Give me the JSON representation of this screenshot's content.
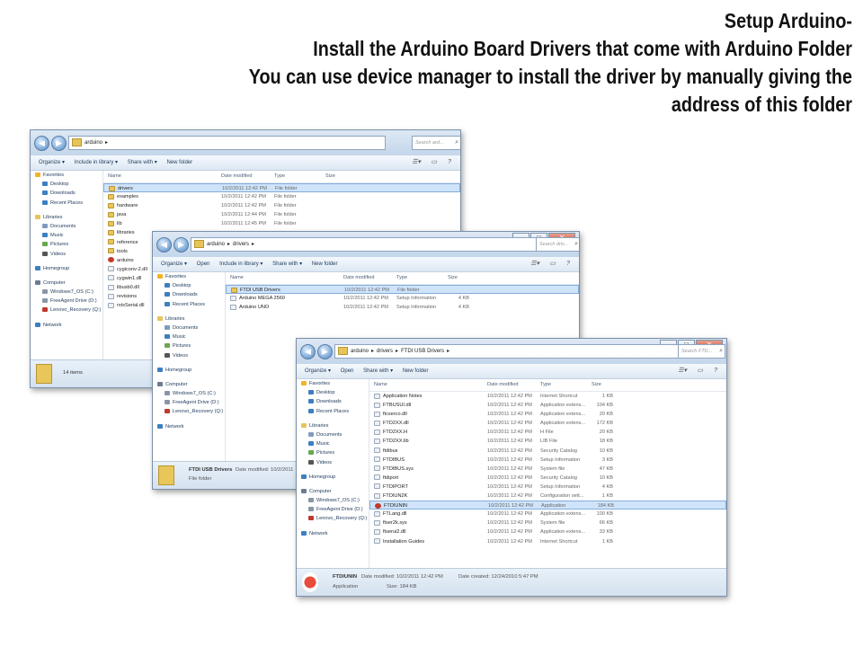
{
  "heading": {
    "line1": "Setup Arduino-",
    "line2": "Install the Arduino Board Drivers that come with Arduino Folder",
    "line3": "You can use device manager to install the driver by manually giving the",
    "line4": "address of this folder"
  },
  "columns": {
    "name": "Name",
    "date": "Date modified",
    "type": "Type",
    "size": "Size"
  },
  "nav": {
    "favorites": "Favorites",
    "desktop": "Desktop",
    "downloads": "Downloads",
    "recent": "Recent Places",
    "libraries": "Libraries",
    "documents": "Documents",
    "music": "Music",
    "pictures": "Pictures",
    "videos": "Videos",
    "homegroup": "Homegroup",
    "computer": "Computer",
    "drive_c": "Windows7_OS (C:)",
    "drive_d": "FreeAgent Drive (D:)",
    "drive_q": "Lenovo_Recovery (Q:)",
    "network": "Network"
  },
  "toolbar": {
    "organize": "Organize ▾",
    "open": "Open",
    "include": "Include in library ▾",
    "share": "Share with ▾",
    "newfolder": "New folder"
  },
  "win1": {
    "crumbs": [
      "arduino"
    ],
    "search_placeholder": "Search ard...",
    "rows": [
      {
        "name": "drivers",
        "date": "10/2/2011 12:42 PM",
        "type": "File folder",
        "kind": "folder"
      },
      {
        "name": "examples",
        "date": "10/2/2011 12:42 PM",
        "type": "File folder",
        "kind": "folder"
      },
      {
        "name": "hardware",
        "date": "10/2/2011 12:42 PM",
        "type": "File folder",
        "kind": "folder"
      },
      {
        "name": "java",
        "date": "10/2/2011 12:44 PM",
        "type": "File folder",
        "kind": "folder"
      },
      {
        "name": "lib",
        "date": "10/2/2011 12:45 PM",
        "type": "File folder",
        "kind": "folder"
      },
      {
        "name": "libraries",
        "date": "",
        "type": "",
        "kind": "folder"
      },
      {
        "name": "reference",
        "date": "",
        "type": "",
        "kind": "folder"
      },
      {
        "name": "tools",
        "date": "",
        "type": "",
        "kind": "folder"
      },
      {
        "name": "arduino",
        "date": "",
        "type": "",
        "kind": "app"
      },
      {
        "name": "cygiconv-2.dll",
        "date": "",
        "type": "",
        "kind": "file"
      },
      {
        "name": "cygwin1.dll",
        "date": "",
        "type": "",
        "kind": "file"
      },
      {
        "name": "libusb0.dll",
        "date": "",
        "type": "",
        "kind": "file"
      },
      {
        "name": "revisions",
        "date": "",
        "type": "",
        "kind": "file"
      },
      {
        "name": "rxtxSerial.dll",
        "date": "",
        "type": "",
        "kind": "file"
      }
    ],
    "status": "14 items"
  },
  "win2": {
    "crumbs": [
      "arduino",
      "drivers"
    ],
    "search_placeholder": "Search driv...",
    "rows": [
      {
        "name": "FTDI USB Drivers",
        "date": "10/2/2011 12:42 PM",
        "type": "File folder",
        "size": "",
        "kind": "folder"
      },
      {
        "name": "Arduino MEGA 2560",
        "date": "10/2/2011 12:42 PM",
        "type": "Setup Information",
        "size": "4 KB",
        "kind": "file"
      },
      {
        "name": "Arduino UNO",
        "date": "10/2/2011 12:42 PM",
        "type": "Setup Information",
        "size": "4 KB",
        "kind": "file"
      }
    ],
    "status_name": "FTDI USB Drivers",
    "status_date": "Date modified: 10/2/2011",
    "status_type": "File folder"
  },
  "win3": {
    "crumbs": [
      "arduino",
      "drivers",
      "FTDI USB Drivers"
    ],
    "search_placeholder": "Search FTD...",
    "rows": [
      {
        "name": "Application Notes",
        "date": "10/2/2011 12:42 PM",
        "type": "Internet Shortcut",
        "size": "1 KB",
        "kind": "file"
      },
      {
        "name": "FTBUSUI.dll",
        "date": "10/2/2011 12:42 PM",
        "type": "Application extens...",
        "size": "104 KB",
        "kind": "file"
      },
      {
        "name": "ftcserco.dll",
        "date": "10/2/2011 12:42 PM",
        "type": "Application extens...",
        "size": "20 KB",
        "kind": "file"
      },
      {
        "name": "FTD2XX.dll",
        "date": "10/2/2011 12:42 PM",
        "type": "Application extens...",
        "size": "172 KB",
        "kind": "file"
      },
      {
        "name": "FTD2XX.H",
        "date": "10/2/2011 12:42 PM",
        "type": "H File",
        "size": "20 KB",
        "kind": "file"
      },
      {
        "name": "FTD2XX.lib",
        "date": "10/2/2011 12:42 PM",
        "type": "LIB File",
        "size": "18 KB",
        "kind": "file"
      },
      {
        "name": "ftdibus",
        "date": "10/2/2011 12:42 PM",
        "type": "Security Catalog",
        "size": "10 KB",
        "kind": "file"
      },
      {
        "name": "FTDIBUS",
        "date": "10/2/2011 12:42 PM",
        "type": "Setup Information",
        "size": "3 KB",
        "kind": "file"
      },
      {
        "name": "FTDIBUS.sys",
        "date": "10/2/2011 12:42 PM",
        "type": "System file",
        "size": "47 KB",
        "kind": "file"
      },
      {
        "name": "ftdiport",
        "date": "10/2/2011 12:42 PM",
        "type": "Security Catalog",
        "size": "10 KB",
        "kind": "file"
      },
      {
        "name": "FTDIPORT",
        "date": "10/2/2011 12:42 PM",
        "type": "Setup Information",
        "size": "4 KB",
        "kind": "file"
      },
      {
        "name": "FTDIUN2K",
        "date": "10/2/2011 12:42 PM",
        "type": "Configuration sett...",
        "size": "1 KB",
        "kind": "file"
      },
      {
        "name": "FTDIUNIN",
        "date": "10/2/2011 12:42 PM",
        "type": "Application",
        "size": "184 KB",
        "kind": "app"
      },
      {
        "name": "FTLang.dll",
        "date": "10/2/2011 12:42 PM",
        "type": "Application extens...",
        "size": "100 KB",
        "kind": "file"
      },
      {
        "name": "ftser2k.sys",
        "date": "10/2/2011 12:42 PM",
        "type": "System file",
        "size": "66 KB",
        "kind": "file"
      },
      {
        "name": "ftserui2.dll",
        "date": "10/2/2011 12:42 PM",
        "type": "Application extens...",
        "size": "33 KB",
        "kind": "file"
      },
      {
        "name": "Installation Guides",
        "date": "10/2/2011 12:42 PM",
        "type": "Internet Shortcut",
        "size": "1 KB",
        "kind": "file"
      }
    ],
    "status_name": "FTDIUNIN",
    "status_date": "Date modified: 10/2/2011 12:42 PM",
    "status_created": "Date created: 12/24/2010 5:47 PM",
    "status_type": "Application",
    "status_size": "Size: 184 KB"
  }
}
